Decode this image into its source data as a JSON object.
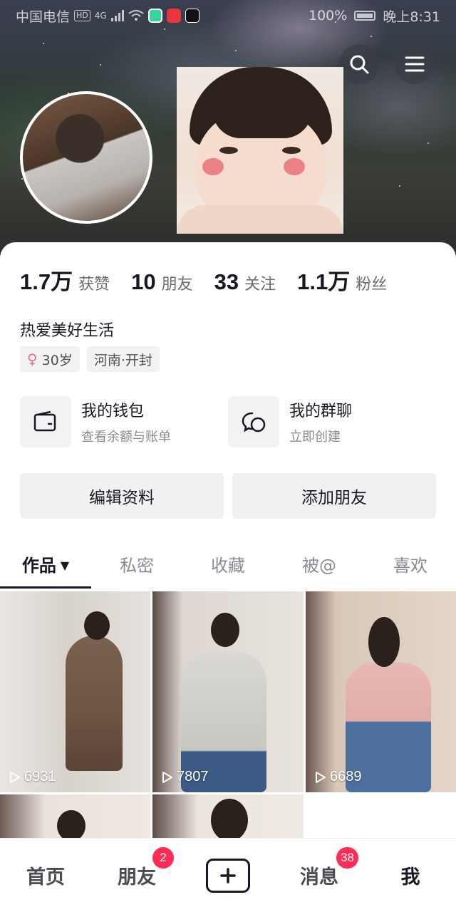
{
  "status_bar": {
    "carrier": "中国电信",
    "hd_badge": "HD",
    "network": "4G",
    "battery": "100%",
    "time": "晚上8:31"
  },
  "header": {
    "search_icon": "search-icon",
    "menu_icon": "menu-icon"
  },
  "stats": [
    {
      "value": "1.7万",
      "label": "获赞"
    },
    {
      "value": "10",
      "label": "朋友"
    },
    {
      "value": "33",
      "label": "关注"
    },
    {
      "value": "1.1万",
      "label": "粉丝"
    }
  ],
  "bio": "热爱美好生活",
  "tags": {
    "age": "30岁",
    "location": "河南·开封"
  },
  "services": [
    {
      "title": "我的钱包",
      "subtitle": "查看余额与账单",
      "icon": "wallet-icon"
    },
    {
      "title": "我的群聊",
      "subtitle": "立即创建",
      "icon": "group-chat-icon"
    }
  ],
  "actions": {
    "edit_profile": "编辑资料",
    "add_friend": "添加朋友"
  },
  "tabs": [
    "作品",
    "私密",
    "收藏",
    "被@",
    "喜欢"
  ],
  "tab_caret": "▼",
  "videos": [
    {
      "plays": "6931"
    },
    {
      "plays": "7807"
    },
    {
      "plays": "6689"
    }
  ],
  "bottom_nav": {
    "home": "首页",
    "friends": "朋友",
    "friends_badge": "2",
    "messages": "消息",
    "messages_badge": "38",
    "me": "我"
  },
  "colors": {
    "accent": "#fe2c55",
    "text": "#161823",
    "muted": "#8a8b91"
  }
}
